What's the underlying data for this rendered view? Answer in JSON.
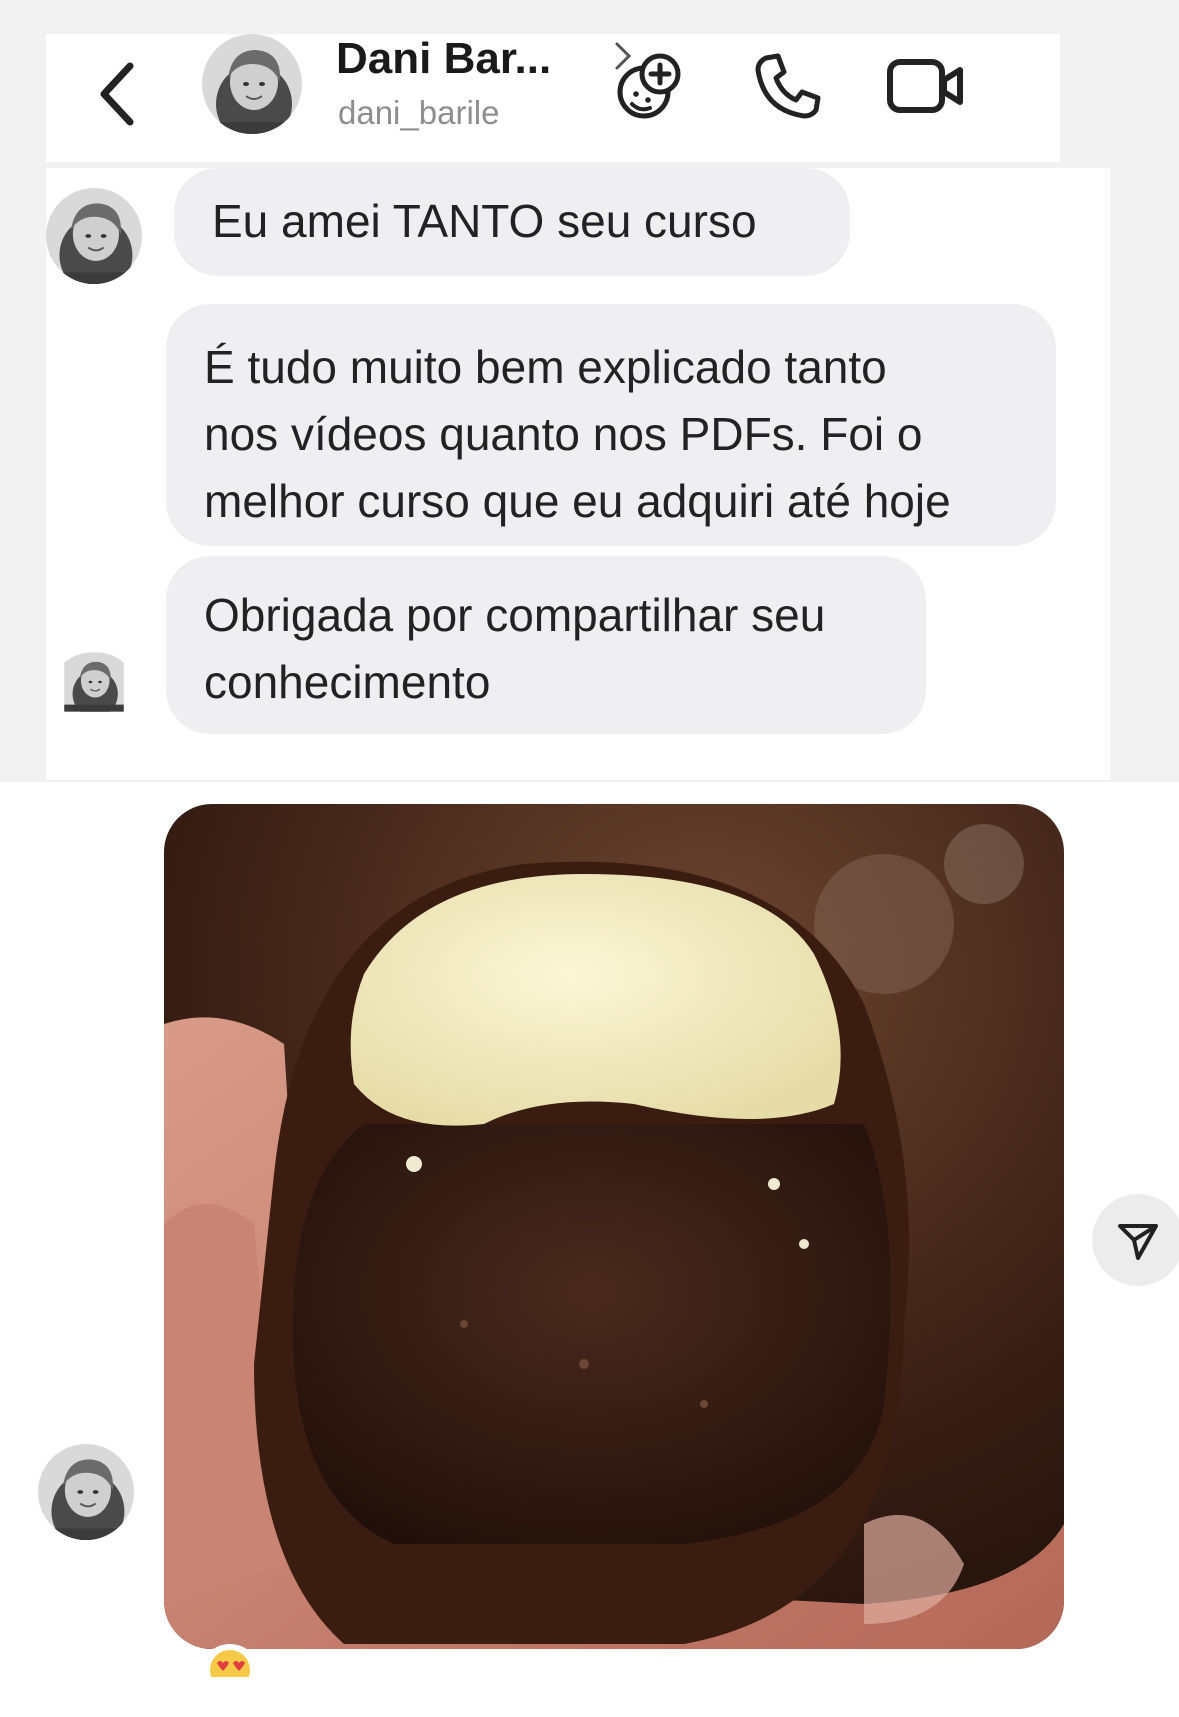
{
  "header": {
    "contact_name": "Dani Bar...",
    "username": "dani_barile",
    "icons": {
      "back": "chevron-left-icon",
      "name_chevron": "chevron-right-icon",
      "effects": "face-plus-icon",
      "call": "phone-icon",
      "video": "video-camera-icon"
    }
  },
  "messages": [
    {
      "text": "Eu amei TANTO seu curso"
    },
    {
      "text": "É tudo muito bem explicado tanto\nnos vídeos quanto nos PDFs. Foi o\nmelhor curso que eu adquiri até hoje"
    },
    {
      "text": "Obrigada por compartilhar seu\nconhecimento"
    }
  ],
  "photo_message": {
    "description_icon": "chocolate-bonbon-photo",
    "reaction": "heart-eyes-emoji",
    "share_icon": "send-icon"
  },
  "colors": {
    "bubble": "#efeff1",
    "background": "#ffffff",
    "secondary_text": "#8e8e8e"
  }
}
